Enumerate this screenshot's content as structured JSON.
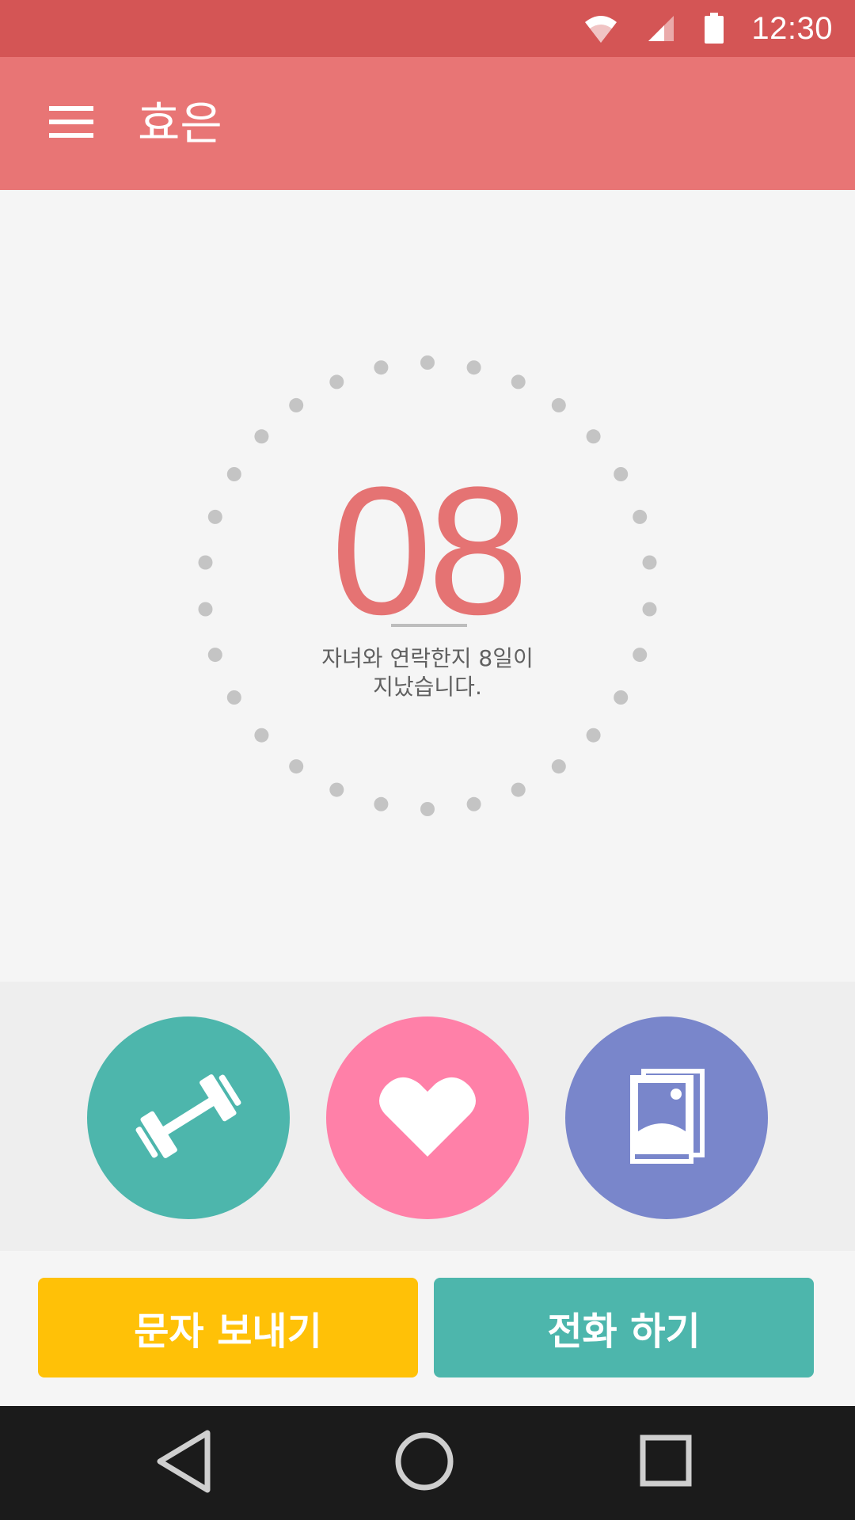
{
  "status_bar": {
    "time": "12:30",
    "icons": [
      "wifi-icon",
      "signal-icon",
      "battery-icon"
    ]
  },
  "app_bar": {
    "title": "효은",
    "menu_icon": "menu-icon"
  },
  "counter": {
    "value": "08",
    "message_line1": "자녀와 연락한지 8일이",
    "message_line2": "지났습니다."
  },
  "actions": [
    {
      "icon": "dumbbell-icon",
      "color": "#4db6ac"
    },
    {
      "icon": "heart-icon",
      "color": "#ff80a8"
    },
    {
      "icon": "photos-icon",
      "color": "#7986cb"
    }
  ],
  "buttons": {
    "sms_label": "문자 보내기",
    "call_label": "전화 하기"
  },
  "nav": {
    "icons": [
      "back-icon",
      "home-icon",
      "recent-apps-icon"
    ]
  },
  "colors": {
    "status_bar": "#d45555",
    "app_bar": "#e87575",
    "accent": "#e57373",
    "sms_button": "#ffc107",
    "call_button": "#4db6ac"
  }
}
